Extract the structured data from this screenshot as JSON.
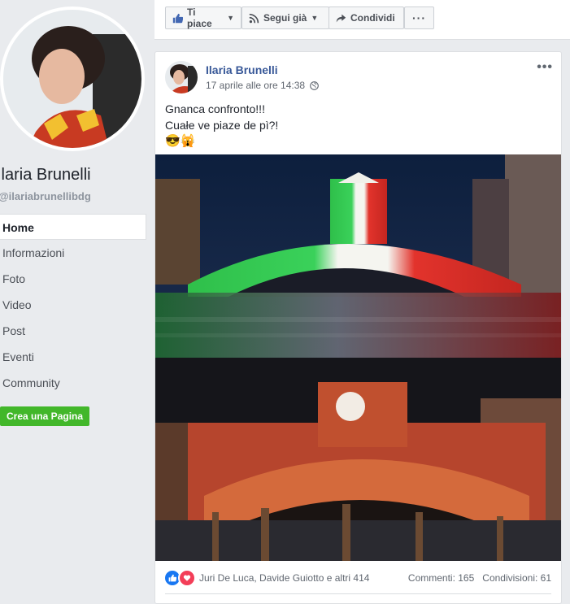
{
  "page": {
    "name": "Ilaria Brunelli",
    "handle": "@ilariabrunellibdg"
  },
  "sidebar": {
    "items": [
      {
        "label": "Home",
        "active": true
      },
      {
        "label": "Informazioni"
      },
      {
        "label": "Foto"
      },
      {
        "label": "Video"
      },
      {
        "label": "Post"
      },
      {
        "label": "Eventi"
      },
      {
        "label": "Community"
      }
    ],
    "create_page": "Crea una Pagina"
  },
  "actions": {
    "like": "Ti piace",
    "follow": "Segui già",
    "share": "Condividi",
    "more": "···"
  },
  "post": {
    "author": "Ilaria Brunelli",
    "date": "17 aprile alle ore 14:38",
    "text_line1": "Gnanca confronto!!!",
    "text_line2": "Cuałe ve piaze de pì?!",
    "emojis": "😎🙀",
    "menu": "•••",
    "reactions": {
      "names": "Juri De Luca, Davide Guiotto e altri 414",
      "comments": "Commenti: 165",
      "shares": "Condivisioni: 61"
    }
  },
  "colors": {
    "accent": "#385898",
    "like_blue": "#1877f2",
    "love_red": "#f33e58",
    "create_green": "#42b72a"
  }
}
